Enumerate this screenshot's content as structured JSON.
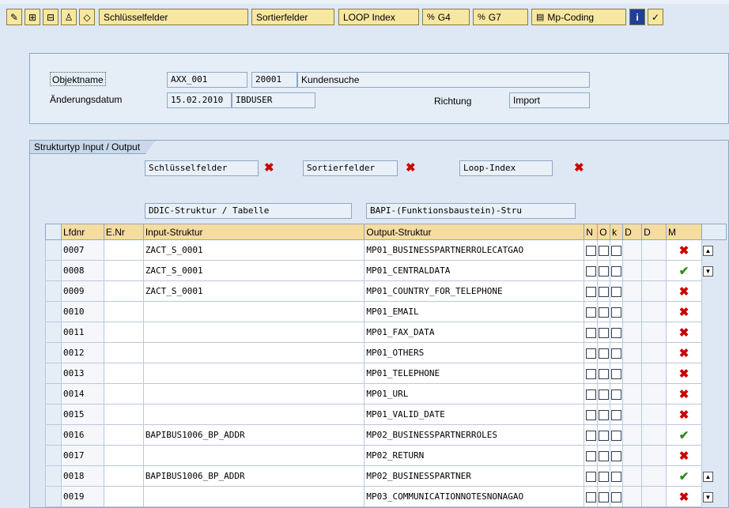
{
  "toolbar": {
    "icons": [
      "pencil-glasses-icon",
      "add-plus-icon",
      "save-minus-icon",
      "person-icon",
      "tag-icon"
    ],
    "buttons": {
      "key_fields": "Schlüsselfelder",
      "sort_fields": "Sortierfelder",
      "loop_index": "LOOP Index",
      "g4": "G4",
      "g7": "G7",
      "mp_coding": "Mp-Coding"
    }
  },
  "header": {
    "object_name_label": "Objektname",
    "object_name": "AXX_001",
    "object_number": "20001",
    "object_desc": "Kundensuche",
    "change_date_label": "Änderungsdatum",
    "change_date": "15.02.2010",
    "change_user": "IBDUSER",
    "direction_label": "Richtung",
    "direction": "Import"
  },
  "structure": {
    "tab_label": "Strukturtyp Input / Output",
    "key_fields": "Schlüsselfelder",
    "sort_fields": "Sortierfelder",
    "loop_index": "Loop-Index",
    "ddic_label": "DDIC-Struktur / Tabelle",
    "bapi_label": "BAPI-(Funktionsbaustein)-Stru"
  },
  "table": {
    "columns": [
      "Lfdnr",
      "E.Nr",
      "Input-Struktur",
      "Output-Struktur",
      "N",
      "O",
      "k",
      "D",
      "D",
      "M"
    ],
    "rows": [
      {
        "lfdnr": "0007",
        "enr": "",
        "input": "ZACT_S_0001",
        "output": "MP01_BUSINESSPARTNERROLECATGAO",
        "status": "x"
      },
      {
        "lfdnr": "0008",
        "enr": "",
        "input": "ZACT_S_0001",
        "output": "MP01_CENTRALDATA",
        "status": "ok"
      },
      {
        "lfdnr": "0009",
        "enr": "",
        "input": "ZACT_S_0001",
        "output": "MP01_COUNTRY_FOR_TELEPHONE",
        "status": "x"
      },
      {
        "lfdnr": "0010",
        "enr": "",
        "input": "",
        "output": "MP01_EMAIL",
        "status": "x"
      },
      {
        "lfdnr": "0011",
        "enr": "",
        "input": "",
        "output": "MP01_FAX_DATA",
        "status": "x"
      },
      {
        "lfdnr": "0012",
        "enr": "",
        "input": "",
        "output": "MP01_OTHERS",
        "status": "x"
      },
      {
        "lfdnr": "0013",
        "enr": "",
        "input": "",
        "output": "MP01_TELEPHONE",
        "status": "x"
      },
      {
        "lfdnr": "0014",
        "enr": "",
        "input": "",
        "output": "MP01_URL",
        "status": "x"
      },
      {
        "lfdnr": "0015",
        "enr": "",
        "input": "",
        "output": "MP01_VALID_DATE",
        "status": "x"
      },
      {
        "lfdnr": "0016",
        "enr": "",
        "input": "BAPIBUS1006_BP_ADDR",
        "output": "MP02_BUSINESSPARTNERROLES",
        "status": "ok"
      },
      {
        "lfdnr": "0017",
        "enr": "",
        "input": "",
        "output": "MP02_RETURN",
        "status": "x"
      },
      {
        "lfdnr": "0018",
        "enr": "",
        "input": "BAPIBUS1006_BP_ADDR",
        "output": "MP02_BUSINESSPARTNER",
        "status": "ok"
      },
      {
        "lfdnr": "0019",
        "enr": "",
        "input": "",
        "output": "MP03_COMMUNICATIONNOTESNONAGAO",
        "status": "x"
      }
    ]
  }
}
